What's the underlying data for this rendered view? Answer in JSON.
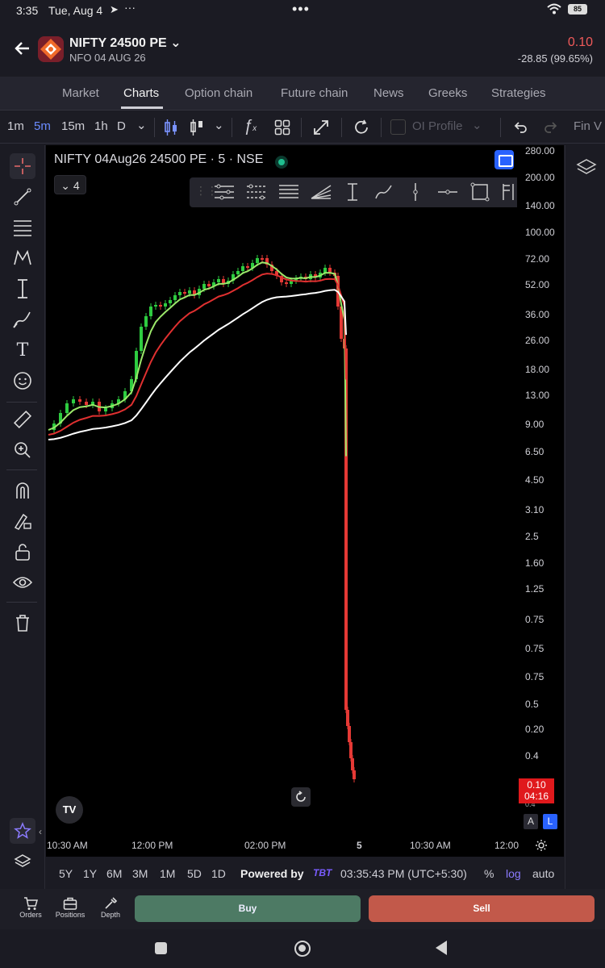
{
  "status_bar": {
    "time": "3:35",
    "date": "Tue, Aug 4",
    "extra": "▲ ···",
    "center_dots": "•••",
    "battery": "85"
  },
  "header": {
    "title": "NIFTY 24500 PE",
    "subtitle": "NFO 04 AUG 26",
    "ltp": "0.10",
    "change": "-28.85 (99.65%)"
  },
  "tabs": [
    "Market",
    "Charts",
    "Option chain",
    "Future chain",
    "News",
    "Greeks",
    "Strategies"
  ],
  "active_tab": "Charts",
  "toolbar": {
    "intervals": [
      "1m",
      "5m",
      "15m",
      "1h",
      "D"
    ],
    "active_interval": "5m",
    "oi_profile": "OI Profile",
    "fin": "Fin V"
  },
  "chart": {
    "title": "NIFTY 04Aug26 24500 PE · 5 · NSE",
    "collapse_label": "4",
    "last_price_label": "0.10",
    "countdown": "04:16",
    "a_btn": "A",
    "l_btn": "L"
  },
  "price_axis": [
    "280.00",
    "200.00",
    "140.00",
    "100.00",
    "72.00",
    "52.00",
    "36.00",
    "26.00",
    "18.00",
    "13.00",
    "9.00",
    "6.50",
    "4.50",
    "3.10",
    "2.5",
    "1.60",
    "1.25",
    "0.75",
    "0.75",
    "0.75",
    "0.5",
    "0.20",
    "0.4",
    "0.4"
  ],
  "time_axis": [
    "10:30 AM",
    "12:00 PM",
    "02:00 PM",
    "5",
    "10:30 AM",
    "12:00"
  ],
  "range_bar": {
    "ranges": [
      "5Y",
      "1Y",
      "6M",
      "3M",
      "1M",
      "5D",
      "1D"
    ],
    "powered_by": "Powered by",
    "brand": "TBT",
    "clock": "03:35:43 PM (UTC+5:30)",
    "pct": "%",
    "log": "log",
    "auto": "auto"
  },
  "order_bar": {
    "orders": "Orders",
    "positions": "Positions",
    "depth": "Depth",
    "buy": "Buy",
    "sell": "Sell"
  },
  "colors": {
    "up": "#2ecc40",
    "down": "#e53935",
    "ema_fast": "#9be86a",
    "ema_mid": "#e03030",
    "ema_slow": "#ffffff",
    "accent": "#2962ff"
  }
}
